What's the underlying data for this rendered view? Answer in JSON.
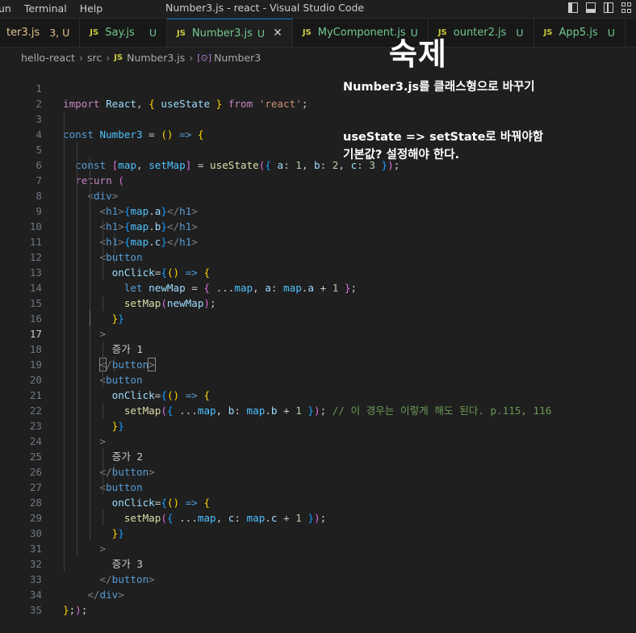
{
  "titlebar": {
    "menu": [
      "un",
      "Terminal",
      "Help"
    ],
    "title": "Number3.js - react - Visual Studio Code"
  },
  "tabs": [
    {
      "name": "ter3.js",
      "status": "3, U",
      "active": false,
      "lang": ""
    },
    {
      "name": "Say.js",
      "status": "U",
      "active": false,
      "lang": "JS"
    },
    {
      "name": "Number3.js",
      "status": "U",
      "active": true,
      "lang": "JS"
    },
    {
      "name": "MyComponent.js",
      "status": "U",
      "active": false,
      "lang": "JS"
    },
    {
      "name": "ounter2.js",
      "status": "U",
      "active": false,
      "lang": "JS"
    },
    {
      "name": "App5.js",
      "status": "U",
      "active": false,
      "lang": "JS"
    }
  ],
  "breadcrumb": {
    "items": [
      "hello-react",
      "src",
      "Number3.js",
      "Number3"
    ],
    "js_badge": "JS",
    "symbol_badge": "[⊙]"
  },
  "editor": {
    "current_line": 17,
    "line_numbers": [
      "1",
      "2",
      "3",
      "4",
      "5",
      "6",
      "7",
      "8",
      "9",
      "10",
      "11",
      "12",
      "13",
      "14",
      "15",
      "16",
      "17",
      "18",
      "19",
      "20",
      "21",
      "22",
      "23",
      "24",
      "25",
      "26",
      "27",
      "28",
      "29",
      "30",
      "31",
      "32",
      "33",
      "34",
      "35"
    ]
  },
  "annotations": {
    "title": "숙제",
    "note1": "Number3.js를 클래스형으로 바꾸기",
    "note2": "useState => setState로 바꿔야함",
    "note3": "기본값? 설정해야 한다."
  },
  "code_text": {
    "l16": "증가 1",
    "l23": "증가 2",
    "l30": "증가 3",
    "l20_comment": "// 이 경우는 이렇게 해도 된다. p.115, 116"
  }
}
